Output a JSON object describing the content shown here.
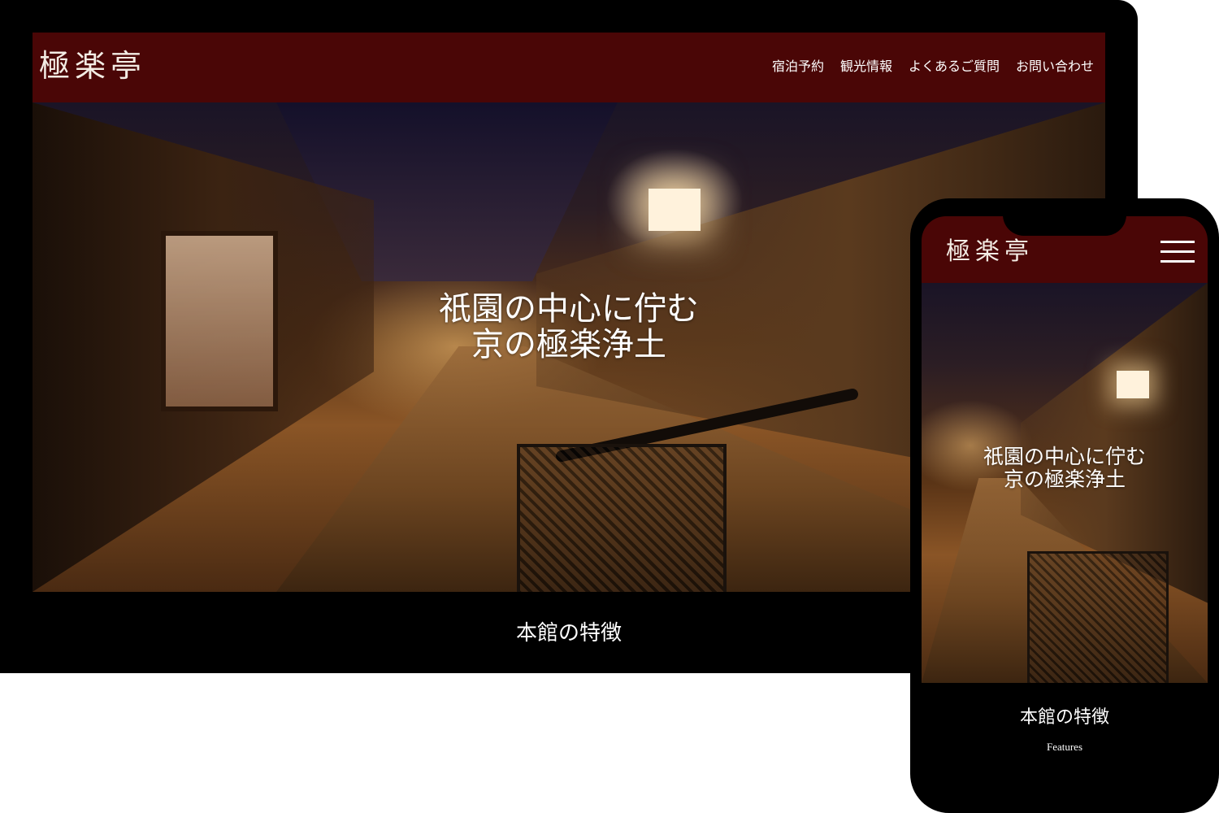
{
  "site": {
    "logo": "極楽亭"
  },
  "desktop": {
    "nav": [
      "宿泊予約",
      "観光情報",
      "よくあるご質問",
      "お問い合わせ"
    ],
    "hero": {
      "tagline_line1": "祇園の中心に佇む",
      "tagline_line2": "京の極楽浄土"
    },
    "section": {
      "title": "本館の特徴"
    }
  },
  "mobile": {
    "hero": {
      "tagline_line1": "祇園の中心に佇む",
      "tagline_line2": "京の極楽浄土"
    },
    "section": {
      "title": "本館の特徴",
      "subtitle": "Features"
    }
  },
  "colors": {
    "header_bg": "#4a0606",
    "page_bg": "#000000",
    "text": "#ffffff"
  },
  "icons": {
    "mobile_menu": "hamburger-icon"
  }
}
